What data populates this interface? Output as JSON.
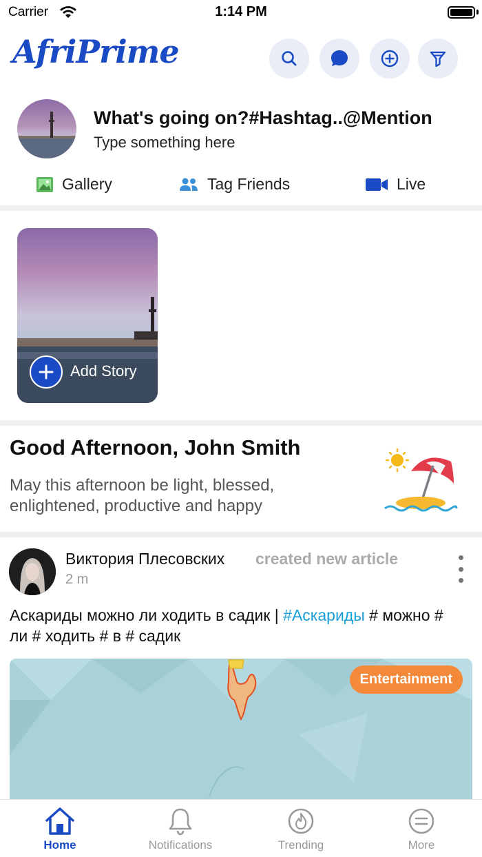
{
  "status_bar": {
    "carrier": "Carrier",
    "time": "1:14 PM"
  },
  "header": {
    "logo": "AfriPrime",
    "actions": [
      "search-icon",
      "messages-icon",
      "create-icon",
      "filter-icon"
    ],
    "accent_color": "#1a4bc4",
    "button_bg": "#e9edf7"
  },
  "composer": {
    "title": "What's going on?#Hashtag..@Mention",
    "placeholder": "Type something here",
    "actions": [
      {
        "label": "Gallery",
        "icon": "gallery-icon",
        "color": "#4caf50"
      },
      {
        "label": "Tag Friends",
        "icon": "tag-friends-icon",
        "color": "#3b8fd8"
      },
      {
        "label": "Live",
        "icon": "video-icon",
        "color": "#1a4bc4"
      }
    ]
  },
  "stories": {
    "add_label": "Add Story",
    "add_icon": "plus-icon"
  },
  "greeting": {
    "title": "Good Afternoon, John Smith",
    "message": "May this afternoon be light, blessed, enlightened, productive and happy",
    "illustration": "beach-umbrella-icon"
  },
  "post": {
    "author": "Виктория Плесовских",
    "action": "created new article",
    "time": "2 m",
    "text_before": "Аскариды можно ли ходить в садик | ",
    "hashtag": "#Аскариды",
    "text_after": " # можно # ли # ходить # в # садик",
    "category": "Entertainment",
    "category_color": "#f5893a",
    "hashtag_color": "#1aa0d8"
  },
  "tabbar": {
    "items": [
      {
        "label": "Home",
        "icon": "home-icon",
        "active": true
      },
      {
        "label": "Notifications",
        "icon": "bell-icon",
        "active": false
      },
      {
        "label": "Trending",
        "icon": "flame-icon",
        "active": false
      },
      {
        "label": "More",
        "icon": "menu-icon",
        "active": false
      }
    ]
  }
}
